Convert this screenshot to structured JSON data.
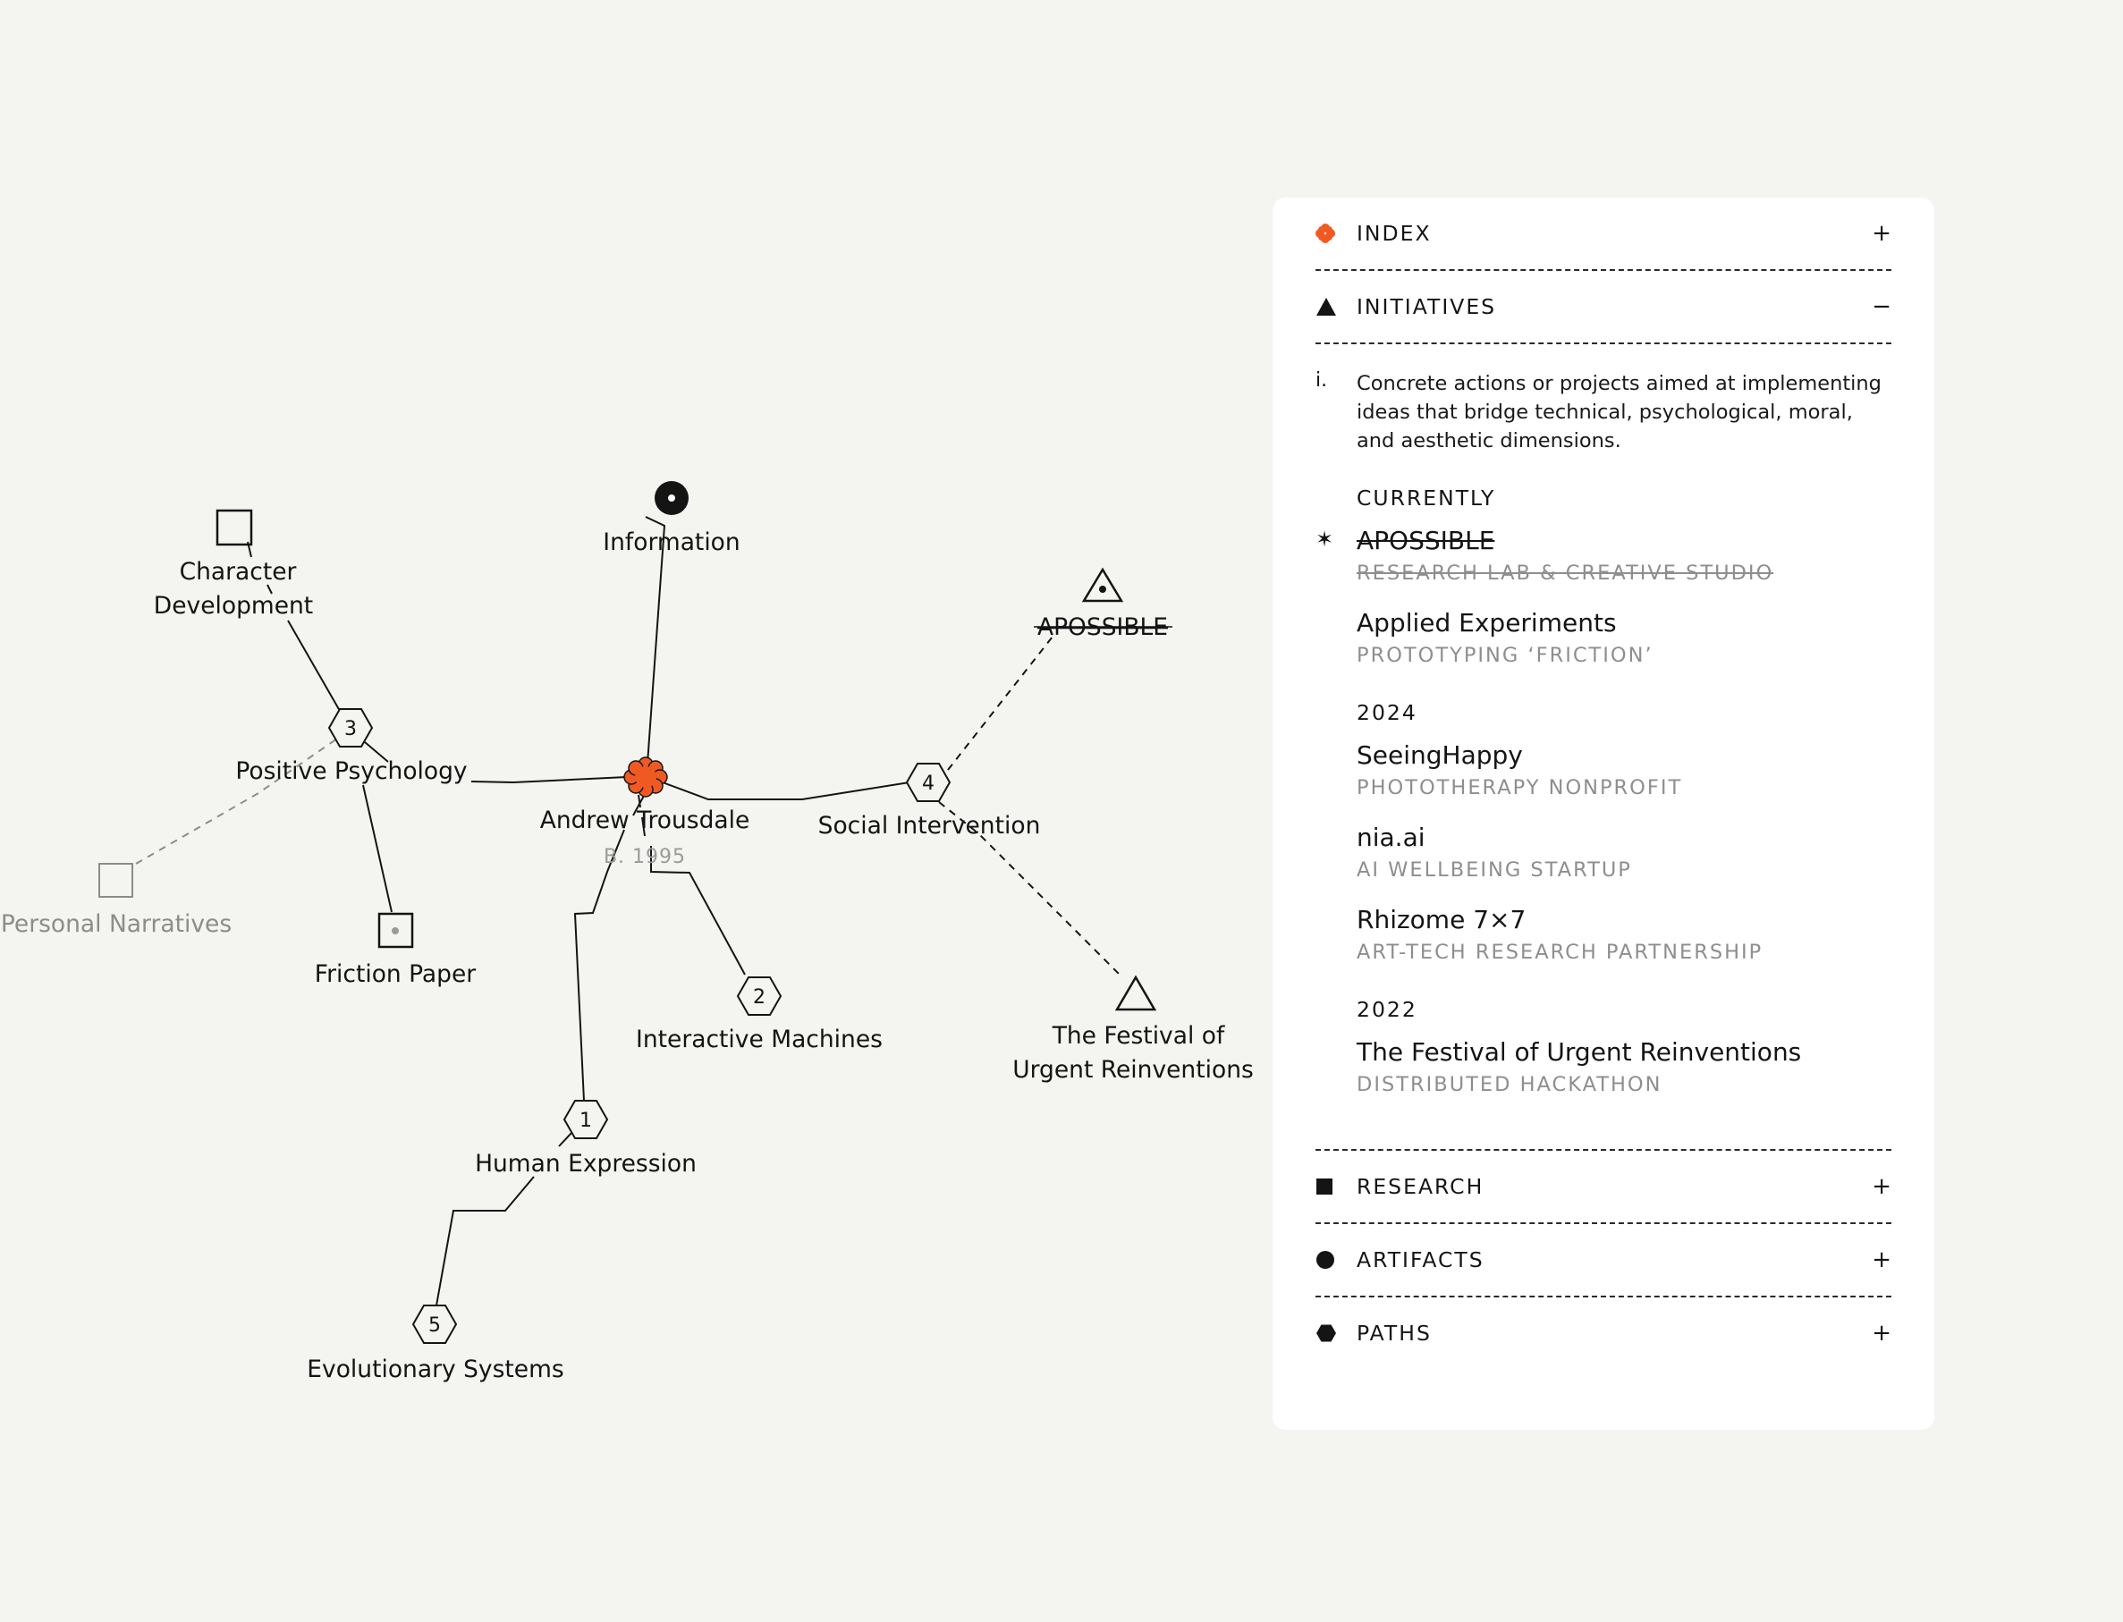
{
  "graph": {
    "center": {
      "label": "Andrew Trousdale",
      "sub": "B. 1995"
    },
    "nodes": {
      "information": "Information",
      "character_development_line1": "Character",
      "character_development_line2": "Development",
      "positive_psychology": "Positive Psychology",
      "personal_narratives": "Personal Narratives",
      "friction_paper": "Friction Paper",
      "apossible": "APOSSIBLE",
      "social_intervention": "Social Intervention",
      "interactive_machines": "Interactive Machines",
      "festival_line1": "The Festival of",
      "festival_line2": "Urgent Reinventions",
      "human_expression": "Human Expression",
      "evolutionary_systems": "Evolutionary Systems"
    },
    "hex_numbers": {
      "positive_psychology": "3",
      "social_intervention": "4",
      "interactive_machines": "2",
      "human_expression": "1",
      "evolutionary_systems": "5"
    },
    "accent_color": "#f05a22"
  },
  "panel": {
    "sections": {
      "index": {
        "label": "INDEX",
        "toggle": "+",
        "icon": "flower-icon"
      },
      "initiatives": {
        "label": "INITIATIVES",
        "toggle": "−",
        "icon": "triangle-icon"
      },
      "research": {
        "label": "RESEARCH",
        "toggle": "+",
        "icon": "square-icon"
      },
      "artifacts": {
        "label": "ARTIFACTS",
        "toggle": "+",
        "icon": "circle-icon"
      },
      "paths": {
        "label": "PATHS",
        "toggle": "+",
        "icon": "hexagon-icon"
      }
    },
    "initiatives": {
      "desc_mark": "i.",
      "description": "Concrete actions or projects aimed at implementing ideas that bridge technical, psychological, moral, and aesthetic dimensions.",
      "groups": [
        {
          "title": "CURRENTLY",
          "items": [
            {
              "name": "APOSSIBLE",
              "sub": "RESEARCH LAB & CREATIVE STUDIO",
              "star": "✶"
            },
            {
              "name": "Applied Experiments",
              "sub": "PROTOTYPING ‘FRICTION’"
            }
          ]
        },
        {
          "title": "2024",
          "items": [
            {
              "name": "SeeingHappy",
              "sub": "PHOTOTHERAPY NONPROFIT"
            },
            {
              "name": "nia.ai",
              "sub": "AI WELLBEING STARTUP"
            },
            {
              "name": "Rhizome 7×7",
              "sub": "ART-TECH RESEARCH PARTNERSHIP"
            }
          ]
        },
        {
          "title": "2022",
          "items": [
            {
              "name": "The Festival of Urgent Reinventions",
              "sub": "DISTRIBUTED HACKATHON"
            }
          ]
        }
      ]
    }
  }
}
